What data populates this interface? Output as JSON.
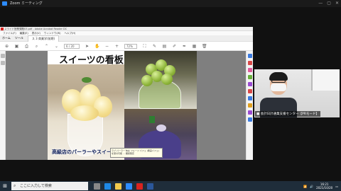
{
  "zoom": {
    "title": "Zoom ミーティング"
  },
  "acrobat": {
    "window_title": "スライド授業課題03.pdf - Adobe Acrobat Reader DC",
    "menu": [
      "ファイル(F)",
      "編集(E)",
      "表示(V)",
      "ウィンドウ(W)",
      "ヘルプ(H)"
    ],
    "tabs": [
      "ホーム",
      "ツール",
      "ス 3 商業学(前期)"
    ],
    "page_current": "6",
    "page_total": "/ 20",
    "zoom_level": "72%"
  },
  "slide": {
    "title": "スイーツの看板",
    "caption": "高級店のパーラーやスイーツで顧客層を広げる",
    "tooltip": "ラブ パーラー 旬な フルーツ パフェ (果実パフェ)を受付可能 … 期間限定"
  },
  "camera": {
    "name_label": "■ 会計日計通業支援センター【PRモード】"
  },
  "taskbar": {
    "search_placeholder": "ここに入力して検索",
    "time": "16:21",
    "date": "2021/10/20"
  }
}
